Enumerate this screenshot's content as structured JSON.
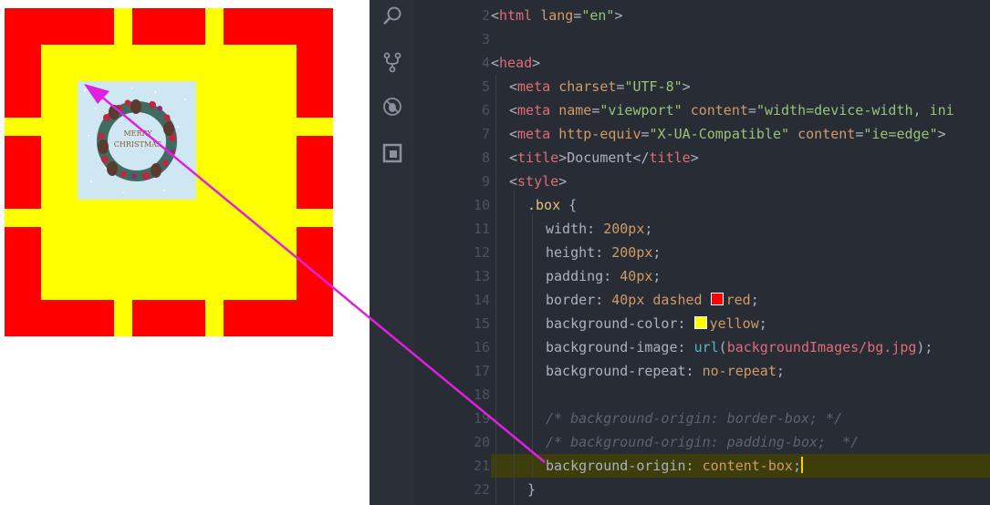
{
  "preview": {
    "box_colors": {
      "border": "#ff0000",
      "background": "#ffff00"
    },
    "image_text": {
      "line1": "MERRY",
      "line2": "CHRISTMAS"
    }
  },
  "activity_bar": {
    "icons": [
      "search-icon",
      "source-control-icon",
      "debug-icon",
      "extensions-icon"
    ]
  },
  "editor": {
    "lines": [
      {
        "n": "2"
      },
      {
        "n": "3"
      },
      {
        "n": "4"
      },
      {
        "n": "5"
      },
      {
        "n": "6"
      },
      {
        "n": "7"
      },
      {
        "n": "8"
      },
      {
        "n": "9"
      },
      {
        "n": "10"
      },
      {
        "n": "11"
      },
      {
        "n": "12"
      },
      {
        "n": "13"
      },
      {
        "n": "14"
      },
      {
        "n": "15"
      },
      {
        "n": "16"
      },
      {
        "n": "17"
      },
      {
        "n": "18"
      },
      {
        "n": "19"
      },
      {
        "n": "20"
      },
      {
        "n": "21"
      },
      {
        "n": "22"
      }
    ],
    "tokens": {
      "l2": [
        "<",
        "html",
        " ",
        "lang",
        "=",
        "\"en\"",
        ">"
      ],
      "l4": [
        "<",
        "head",
        ">"
      ],
      "l5": [
        "<",
        "meta",
        " ",
        "charset",
        "=",
        "\"UTF-8\"",
        ">"
      ],
      "l6": [
        "<",
        "meta",
        " ",
        "name",
        "=",
        "\"viewport\"",
        " ",
        "content",
        "=",
        "\"width=device-width, ini"
      ],
      "l7": [
        "<",
        "meta",
        " ",
        "http-equiv",
        "=",
        "\"X-UA-Compatible\"",
        " ",
        "content",
        "=",
        "\"ie=edge\"",
        ">"
      ],
      "l8": [
        "<",
        "title",
        ">",
        "Document",
        "</",
        "title",
        ">"
      ],
      "l9": [
        "<",
        "style",
        ">"
      ],
      "l10": [
        ".box",
        " {"
      ],
      "l11": [
        "width",
        ": ",
        "200px",
        ";"
      ],
      "l12": [
        "height",
        ": ",
        "200px",
        ";"
      ],
      "l13": [
        "padding",
        ": ",
        "40px",
        ";"
      ],
      "l14": [
        "border",
        ": ",
        "40px",
        " ",
        "dashed",
        " ",
        "red",
        ";"
      ],
      "l15": [
        "background-color",
        ": ",
        "yellow",
        ";"
      ],
      "l16": [
        "background-image",
        ": ",
        "url",
        "(",
        "backgroundImages/bg.jpg",
        ");"
      ],
      "l17": [
        "background-repeat",
        ": ",
        "no-repeat",
        ";"
      ],
      "l19": "/* background-origin: border-box; */",
      "l20": "/* background-origin: padding-box;  */",
      "l21": [
        "background-origin",
        ": ",
        "content-box",
        ";"
      ],
      "l22": "}"
    },
    "swatches": {
      "red": "#ff0000",
      "yellow": "#ffff00"
    },
    "highlight_color": "#3e3d0c"
  },
  "annotation": {
    "arrow_color": "#e020e0"
  }
}
